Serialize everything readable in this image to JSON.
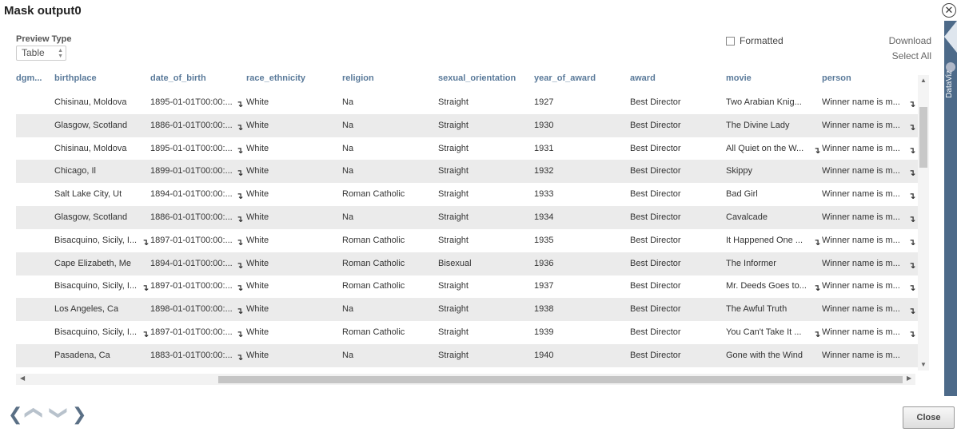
{
  "dialog": {
    "title": "Mask output0",
    "close_icon": "circle-x-icon"
  },
  "preview": {
    "label": "Preview Type",
    "selected": "Table"
  },
  "toolbar": {
    "formatted_label": "Formatted",
    "formatted_checked": false,
    "download_label": "Download",
    "select_all_label": "Select All"
  },
  "table": {
    "columns": [
      "idgm...",
      "birthplace",
      "date_of_birth",
      "race_ethnicity",
      "religion",
      "sexual_orientation",
      "year_of_award",
      "award",
      "movie",
      "person"
    ],
    "rows": [
      [
        "",
        "Chisinau, Moldova",
        "1895-01-01T00:00:...",
        "White",
        "Na",
        "Straight",
        "1927",
        "Best Director",
        "Two Arabian Knig...",
        "Winner name is m..."
      ],
      [
        "",
        "Glasgow, Scotland",
        "1886-01-01T00:00:...",
        "White",
        "Na",
        "Straight",
        "1930",
        "Best Director",
        "The Divine Lady",
        "Winner name is m..."
      ],
      [
        "",
        "Chisinau, Moldova",
        "1895-01-01T00:00:...",
        "White",
        "Na",
        "Straight",
        "1931",
        "Best Director",
        "All Quiet on the W...",
        "Winner name is m..."
      ],
      [
        "",
        "Chicago, Il",
        "1899-01-01T00:00:...",
        "White",
        "Na",
        "Straight",
        "1932",
        "Best Director",
        "Skippy",
        "Winner name is m..."
      ],
      [
        "",
        "Salt Lake City, Ut",
        "1894-01-01T00:00:...",
        "White",
        "Roman Catholic",
        "Straight",
        "1933",
        "Best Director",
        "Bad Girl",
        "Winner name is m..."
      ],
      [
        "",
        "Glasgow, Scotland",
        "1886-01-01T00:00:...",
        "White",
        "Na",
        "Straight",
        "1934",
        "Best Director",
        "Cavalcade",
        "Winner name is m..."
      ],
      [
        "",
        "Bisacquino, Sicily, I...",
        "1897-01-01T00:00:...",
        "White",
        "Roman Catholic",
        "Straight",
        "1935",
        "Best Director",
        "It Happened One ...",
        "Winner name is m..."
      ],
      [
        "",
        "Cape Elizabeth, Me",
        "1894-01-01T00:00:...",
        "White",
        "Roman Catholic",
        "Bisexual",
        "1936",
        "Best Director",
        "The Informer",
        "Winner name is m..."
      ],
      [
        "",
        "Bisacquino, Sicily, I...",
        "1897-01-01T00:00:...",
        "White",
        "Roman Catholic",
        "Straight",
        "1937",
        "Best Director",
        "Mr. Deeds Goes to...",
        "Winner name is m..."
      ],
      [
        "",
        "Los Angeles, Ca",
        "1898-01-01T00:00:...",
        "White",
        "Na",
        "Straight",
        "1938",
        "Best Director",
        "The Awful Truth",
        "Winner name is m..."
      ],
      [
        "",
        "Bisacquino, Sicily, I...",
        "1897-01-01T00:00:...",
        "White",
        "Roman Catholic",
        "Straight",
        "1939",
        "Best Director",
        "You Can't Take It ...",
        "Winner name is m..."
      ],
      [
        "",
        "Pasadena, Ca",
        "1883-01-01T00:00:...",
        "White",
        "Na",
        "Straight",
        "1940",
        "Best Director",
        "Gone with the Wind",
        "Winner name is m..."
      ]
    ],
    "expand_icons": [
      [
        2,
        9
      ],
      [
        2,
        9
      ],
      [
        2,
        8,
        9
      ],
      [
        2,
        9
      ],
      [
        2,
        9
      ],
      [
        2,
        9
      ],
      [
        1,
        2,
        8,
        9
      ],
      [
        2,
        9
      ],
      [
        1,
        2,
        8,
        9
      ],
      [
        2,
        9
      ],
      [
        1,
        2,
        8,
        9
      ],
      [
        2
      ]
    ]
  },
  "side_panel": {
    "label": "DataViz"
  },
  "footer": {
    "close_label": "Close"
  },
  "icons": {
    "expand": "expand-arrow-icon",
    "nav_left": "chevron-left-icon",
    "nav_up": "chevron-up-icon",
    "nav_down": "chevron-down-icon",
    "nav_right": "chevron-right-icon"
  }
}
